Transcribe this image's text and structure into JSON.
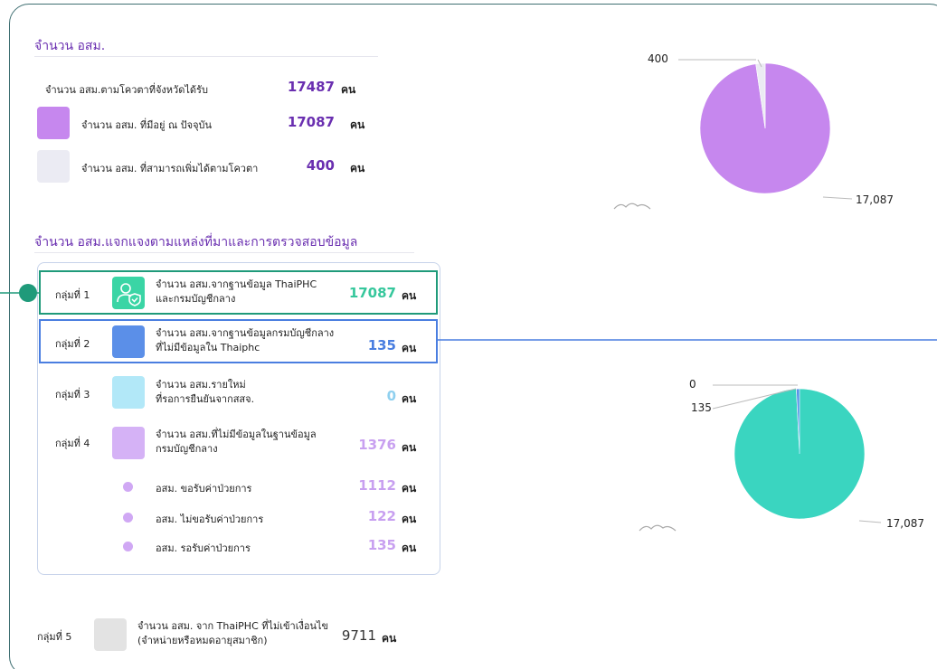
{
  "section1": {
    "title": "จำนวน อสม.",
    "rows": [
      {
        "label": "จำนวน อสม.ตามโควตาที่จังหวัดได้รับ",
        "value": "17487",
        "unit": "คน",
        "color": "#6a2fb0"
      },
      {
        "label": "จำนวน อสม. ที่มีอยู่ ณ ปัจจุบัน",
        "value": "17087",
        "unit": "คน",
        "color": "#6a2fb0",
        "swatch": "#c687ee"
      },
      {
        "label": "จำนวน อสม. ที่สามารถเพิ่มได้ตามโควตา",
        "value": "400",
        "unit": "คน",
        "color": "#6a2fb0",
        "swatch": "#ebebf3"
      }
    ]
  },
  "section2": {
    "title": "จำนวน อสม.แจกแจงตามแหล่งที่มาและการตรวจสอบข้อมูล",
    "groups": [
      {
        "group": "กลุ่มที่ 1",
        "line1": "จำนวน อสม.จากฐานข้อมูล ThaiPHC",
        "line2": "และกรมบัญชีกลาง",
        "value": "17087",
        "unit": "คน",
        "color": "#36c79c",
        "swatch": "#3ad5a5"
      },
      {
        "group": "กลุ่มที่ 2",
        "line1": "จำนวน อสม.จากฐานข้อมูลกรมบัญชีกลาง",
        "line2": "ที่ไม่มีข้อมูลใน Thaiphc",
        "value": "135",
        "unit": "คน",
        "color": "#4a7ee0",
        "swatch": "#5b8fe8"
      },
      {
        "group": "กลุ่มที่ 3",
        "line1": "จำนวน อสม.รายใหม่",
        "line2": "ที่รอการยืนยันจากสสจ.",
        "value": "0",
        "unit": "คน",
        "color": "#8fd0ef",
        "swatch": "#b2e8f8"
      },
      {
        "group": "กลุ่มที่ 4",
        "line1": "จำนวน อสม.ที่ไม่มีข้อมูลในฐานข้อมูล",
        "line2": "กรมบัญชีกลาง",
        "value": "1376",
        "unit": "คน",
        "color": "#c8a0f0",
        "swatch": "#d5b2f6"
      }
    ],
    "subs": [
      {
        "label": "อสม. ขอรับค่าป่วยการ",
        "value": "1112",
        "unit": "คน"
      },
      {
        "label": "อสม. ไม่ขอรับค่าป่วยการ",
        "value": "122",
        "unit": "คน"
      },
      {
        "label": "อสม. รอรับค่าป่วยการ",
        "value": "135",
        "unit": "คน"
      }
    ],
    "group5": {
      "group": "กลุ่มที่ 5",
      "line1": "จำนวน อสม. จาก ThaiPHC ที่ไม่เข้าเงื่อนไข",
      "line2": "(จำหน่ายหรือหมดอายุสมาชิก)",
      "value": "9711",
      "unit": "คน",
      "swatch": "#e3e3e3"
    }
  },
  "chart_data": [
    {
      "type": "pie",
      "slices": [
        {
          "label": "17,087",
          "value": 17087,
          "color": "#c687ee"
        },
        {
          "label": "400",
          "value": 400,
          "color": "#ebebf3"
        }
      ]
    },
    {
      "type": "pie",
      "slices": [
        {
          "label": "17,087",
          "value": 17087,
          "color": "#3ad5c0"
        },
        {
          "label": "135",
          "value": 135,
          "color": "#5b8fe8"
        },
        {
          "label": "0",
          "value": 0,
          "color": "#b2e8f8"
        }
      ]
    }
  ]
}
